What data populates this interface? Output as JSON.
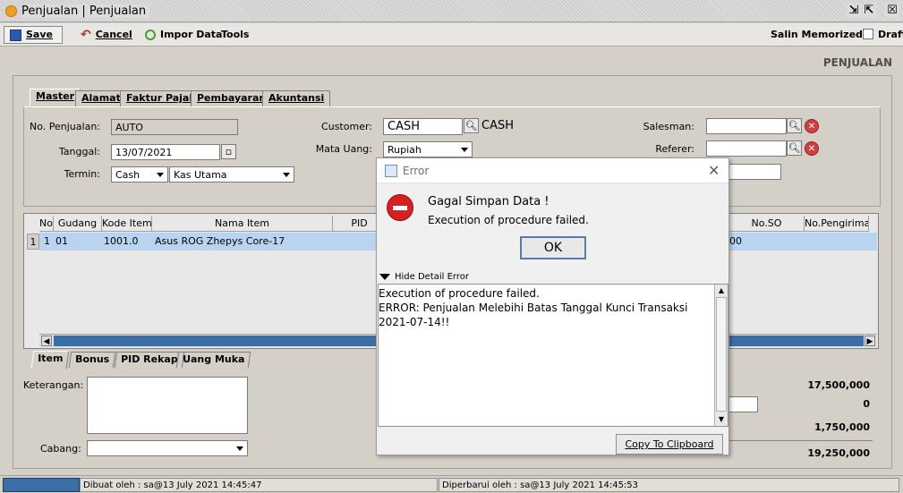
{
  "window": {
    "title": "Penjualan | Penjualan"
  },
  "toolbar": {
    "save": "Save",
    "cancel": "Cancel",
    "impor": "Impor Data",
    "tools": "Tools",
    "salin": "Salin Memorized",
    "draft": "Draft"
  },
  "page_label": "PENJUALAN",
  "tabs": [
    "Master",
    "Alamat",
    "Faktur Pajak",
    "Pembayaran",
    "Akuntansi"
  ],
  "form": {
    "no_penjualan_label": "No. Penjualan:",
    "no_penjualan": "AUTO",
    "tanggal_label": "Tanggal:",
    "tanggal": "13/07/2021",
    "termin_label": "Termin:",
    "termin": "Cash",
    "kas": "Kas Utama",
    "customer_label": "Customer:",
    "customer": "CASH",
    "customer_name": "CASH",
    "mata_uang_label": "Mata Uang:",
    "mata_uang": "Rupiah",
    "salesman_label": "Salesman:",
    "referer_label": "Referer:"
  },
  "table": {
    "headers": [
      "No",
      "Gudang",
      "Kode Item",
      "Nama Item",
      "PID",
      "No.SO",
      "No.Pengiriman"
    ],
    "row": {
      "index": "1",
      "no": "1",
      "gudang": "01",
      "kode": "1001.0",
      "nama": "Asus ROG Zhepys Core-17",
      "partial": "00"
    }
  },
  "bottom_tabs": [
    "Item",
    "Bonus",
    "PID Rekap",
    "Uang Muka"
  ],
  "bottom": {
    "keterangan_label": "Keterangan:",
    "cabang_label": "Cabang:"
  },
  "totals": {
    "subtotal": "17,500,000",
    "diskon": "0",
    "pajak": "1,750,000",
    "total": "19,250,000"
  },
  "status": {
    "dibuat": "Dibuat oleh : sa@13 July 2021  14:45:47",
    "diperbarui": "Diperbarui oleh : sa@13 July 2021  14:45:53"
  },
  "dialog": {
    "title": "Error",
    "message": "Gagal Simpan Data !",
    "sub_message": "Execution of procedure failed.",
    "ok": "OK",
    "toggle": "Hide Detail Error",
    "detail_1": "Execution of procedure failed.",
    "detail_2": "ERROR: Penjualan Melebihi Batas Tanggal Kunci Transaksi",
    "detail_3": "2021-07-14!!",
    "copy": "Copy To Clipboard"
  }
}
